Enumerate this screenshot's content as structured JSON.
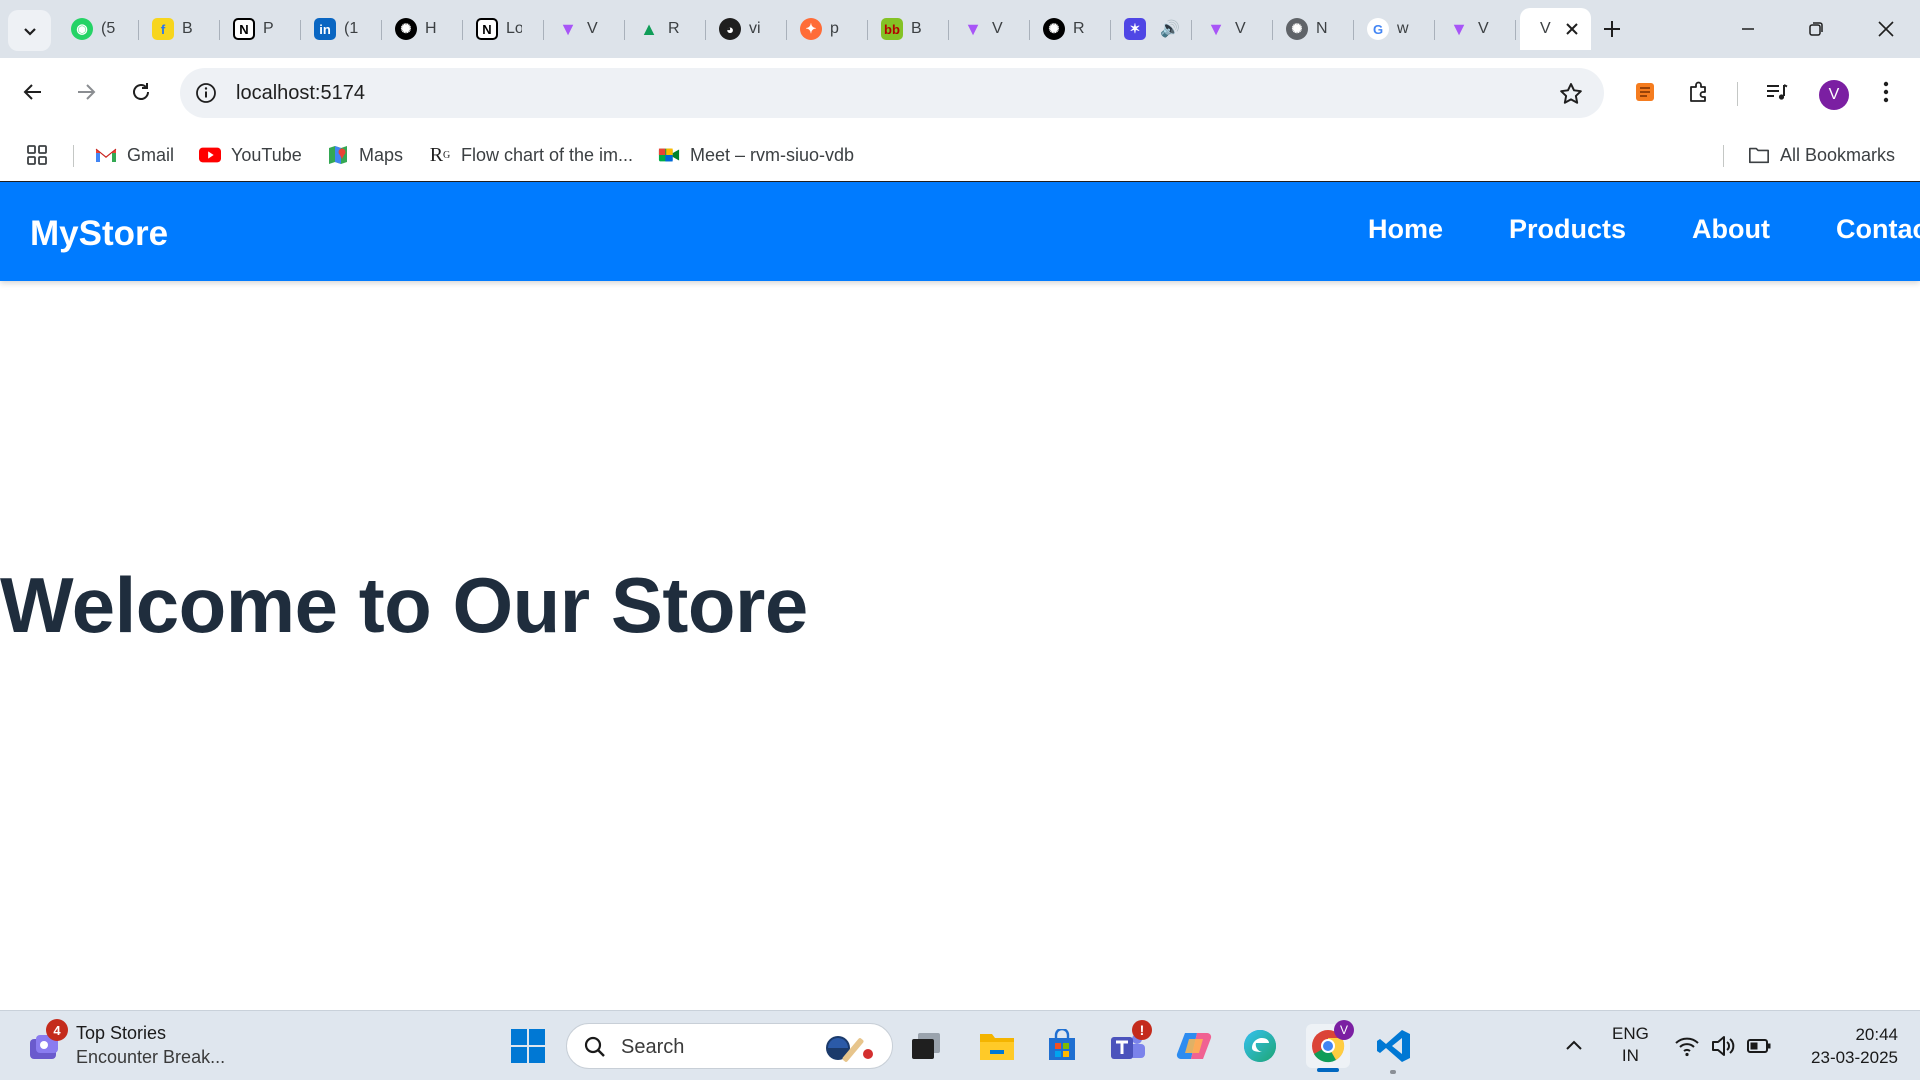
{
  "browser": {
    "tabs": [
      {
        "title": "(5",
        "icon": "whatsapp-icon"
      },
      {
        "title": "B",
        "icon": "flipkart-icon"
      },
      {
        "title": "P",
        "icon": "notion-icon"
      },
      {
        "title": "(1",
        "icon": "linkedin-icon"
      },
      {
        "title": "H",
        "icon": "openai-icon"
      },
      {
        "title": "Lo",
        "icon": "notion-icon"
      },
      {
        "title": "V",
        "icon": "vite-icon"
      },
      {
        "title": "R",
        "icon": "google-drive-icon"
      },
      {
        "title": "vi",
        "icon": "github-icon"
      },
      {
        "title": "p",
        "icon": "postman-icon"
      },
      {
        "title": "B",
        "icon": "bigbasket-icon"
      },
      {
        "title": "V",
        "icon": "vite-icon"
      },
      {
        "title": "R",
        "icon": "openai-icon"
      },
      {
        "title": "",
        "icon": "ai-star-icon"
      },
      {
        "title": "V",
        "icon": "vite-icon"
      },
      {
        "title": "N",
        "icon": "chatgpt-icon"
      },
      {
        "title": "w",
        "icon": "google-icon"
      },
      {
        "title": "V",
        "icon": "vite-icon"
      }
    ],
    "active_tab": {
      "title": "V",
      "icon": "vite-icon"
    },
    "address": "localhost:5174",
    "bookmarks": [
      {
        "label": "Gmail",
        "icon": "gmail-icon"
      },
      {
        "label": "YouTube",
        "icon": "youtube-icon"
      },
      {
        "label": "Maps",
        "icon": "maps-icon"
      },
      {
        "label": "Flow chart of the im...",
        "icon": "researchgate-icon"
      },
      {
        "label": "Meet – rvm-siuo-vdb",
        "icon": "meet-icon"
      }
    ],
    "all_bookmarks": "All Bookmarks",
    "profile_initial": "V"
  },
  "page": {
    "brand": "MyStore",
    "nav": [
      "Home",
      "Products",
      "About",
      "Contact"
    ],
    "hero_title": "Welcome to Our Store",
    "colors": {
      "navbar": "#007bff",
      "hero_text": "#1f2d3d"
    }
  },
  "taskbar": {
    "news_badge": "4",
    "news_title": "Top Stories",
    "news_subtitle": "Encounter Break...",
    "search_placeholder": "Search",
    "lang_line1": "ENG",
    "lang_line2": "IN",
    "time": "20:44",
    "date": "23-03-2025",
    "teams_badge": "!",
    "chrome_badge": "V"
  }
}
